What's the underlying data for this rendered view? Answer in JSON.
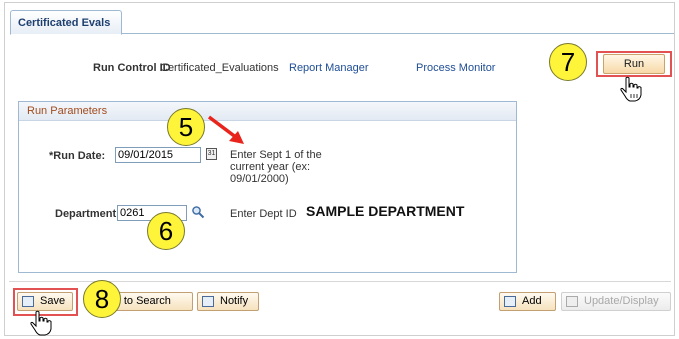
{
  "tab": {
    "label": "Certificated Evals"
  },
  "header": {
    "run_control_label": "Run Control ID",
    "run_control_value": "Certificated_Evaluations",
    "report_manager": "Report Manager",
    "process_monitor": "Process Monitor",
    "run_button": "Run"
  },
  "params": {
    "title": "Run Parameters",
    "run_date_label": "*Run Date:",
    "run_date_value": "09/01/2015",
    "run_date_hint": "Enter Sept 1 of the current year (ex: 09/01/2000)",
    "department_label": "Department:",
    "department_value": "0261",
    "department_hint": "Enter Dept ID",
    "department_name": "SAMPLE DEPARTMENT"
  },
  "toolbar": {
    "save": "Save",
    "return_to_search": "rn to Search",
    "notify": "Notify",
    "add": "Add",
    "update_display": "Update/Display"
  },
  "callouts": {
    "c5": "5",
    "c6": "6",
    "c7": "7",
    "c8": "8"
  },
  "colors": {
    "callout": "#fef43a",
    "highlight": "#e35252",
    "arrow": "#e8241c",
    "link": "#1f4e96"
  },
  "icons": [
    "calendar-icon",
    "lookup-icon",
    "hand-pointer-icon",
    "save-icon",
    "notify-icon",
    "add-icon",
    "update-icon"
  ]
}
